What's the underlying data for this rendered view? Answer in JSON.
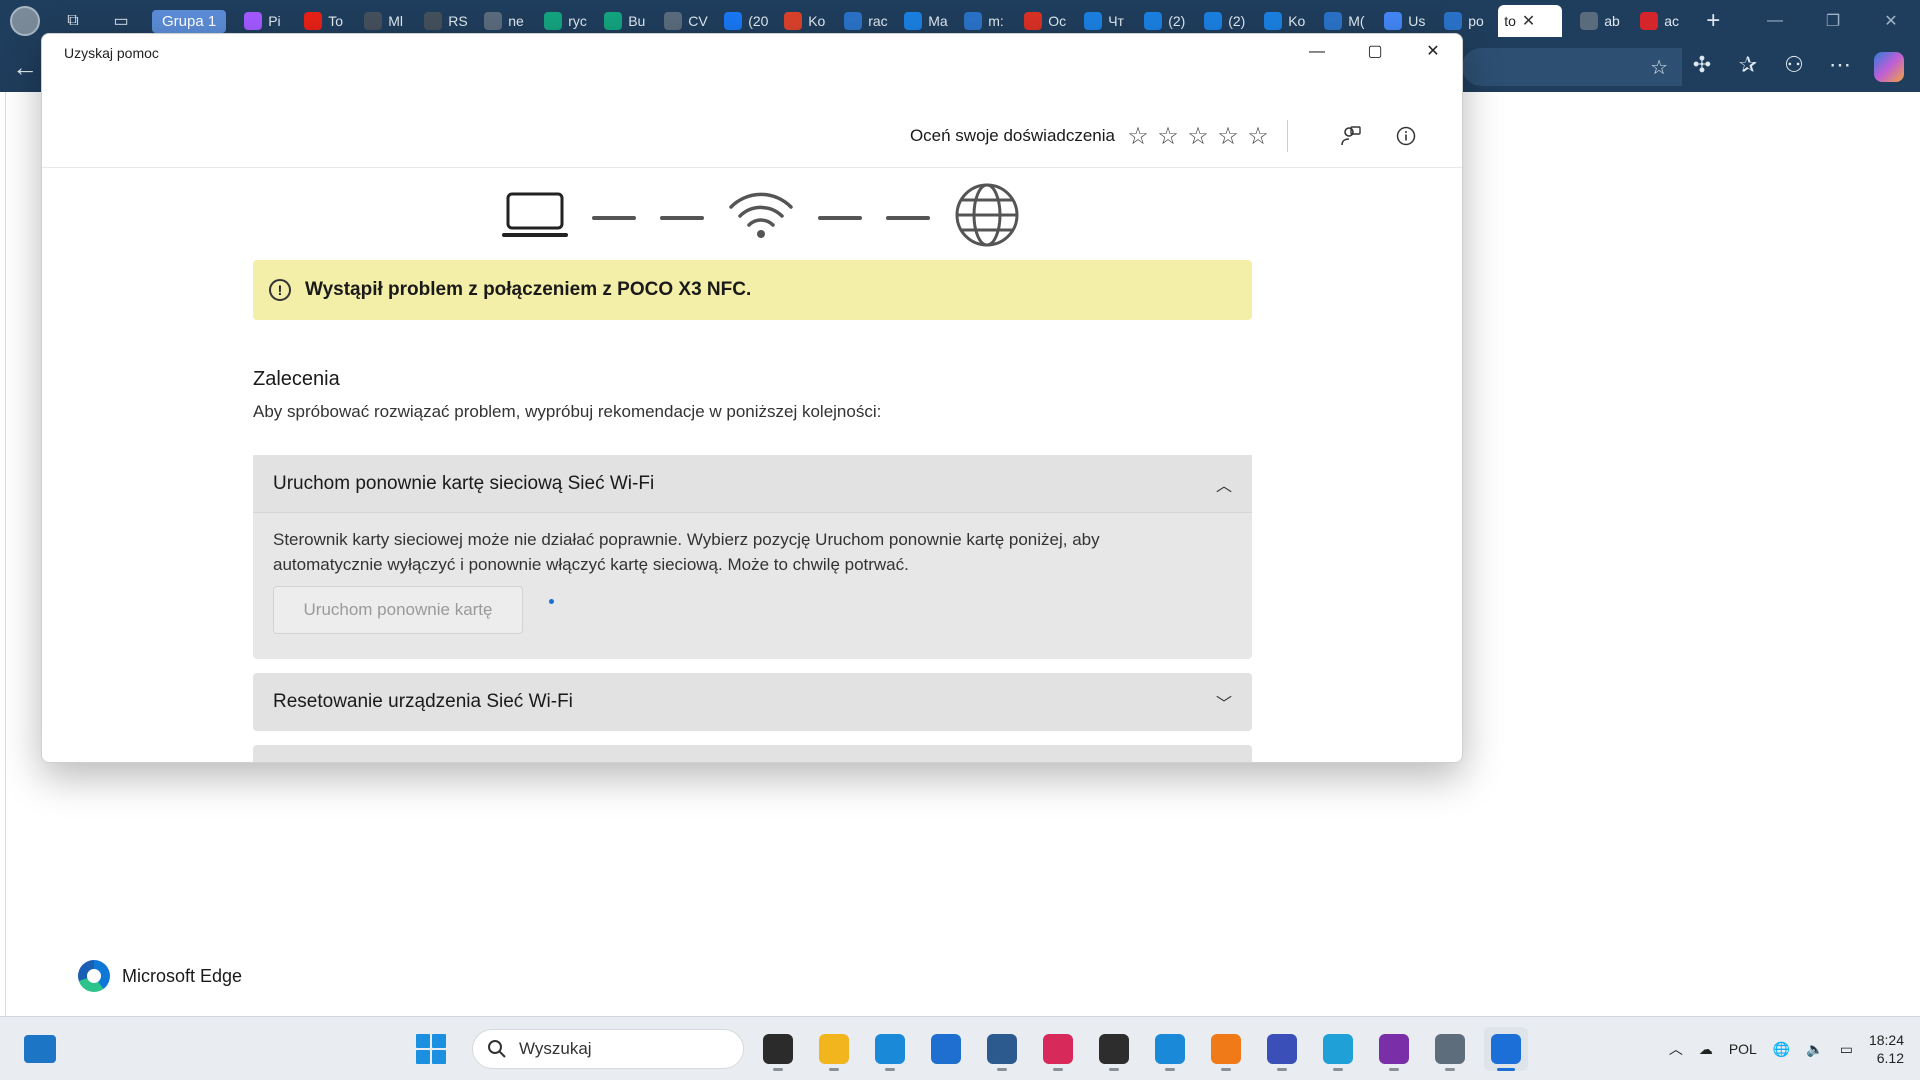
{
  "browser": {
    "tab_group": "Grupa 1",
    "tabs": [
      {
        "label": "Pi",
        "icon": "figma-icon",
        "color": "#a259ff"
      },
      {
        "label": "To",
        "icon": "youtube-icon",
        "color": "#e62117"
      },
      {
        "label": "Ml",
        "icon": "stripes-icon",
        "color": "#44505c"
      },
      {
        "label": "RS",
        "icon": "stripes-icon",
        "color": "#44505c"
      },
      {
        "label": "ne",
        "icon": "globe-icon",
        "color": "#5a6b7d"
      },
      {
        "label": "ryc",
        "icon": "diamond-icon",
        "color": "#14a37f"
      },
      {
        "label": "Bu",
        "icon": "diamond-icon",
        "color": "#14a37f"
      },
      {
        "label": "CV",
        "icon": "globe-icon",
        "color": "#5a6b7d"
      },
      {
        "label": "(20",
        "icon": "facebook-icon",
        "color": "#1877f2"
      },
      {
        "label": "Ko",
        "icon": "check-icon",
        "color": "#d9412b"
      },
      {
        "label": "rac",
        "icon": "search-icon",
        "color": "#2a72c7"
      },
      {
        "label": "Ma",
        "icon": "at-icon",
        "color": "#1b7fe0"
      },
      {
        "label": "m:",
        "icon": "search-icon",
        "color": "#2a72c7"
      },
      {
        "label": "Oc",
        "icon": "gmail-icon",
        "color": "#d93025"
      },
      {
        "label": "Чт",
        "icon": "at-icon",
        "color": "#1b7fe0"
      },
      {
        "label": "(2)",
        "icon": "mail-icon",
        "color": "#1b7fe0"
      },
      {
        "label": "(2)",
        "icon": "mail-icon",
        "color": "#1b7fe0"
      },
      {
        "label": "Ko",
        "icon": "person-icon",
        "color": "#1b7fe0"
      },
      {
        "label": "M(",
        "icon": "search-icon",
        "color": "#2a72c7"
      },
      {
        "label": "Us",
        "icon": "google-icon",
        "color": "#4285f4"
      },
      {
        "label": "po",
        "icon": "search-icon",
        "color": "#2a72c7"
      }
    ],
    "active_tab": {
      "label": "to"
    },
    "tabs_after": [
      {
        "label": "ab",
        "icon": "globe-icon",
        "color": "#5a6b7d"
      },
      {
        "label": "ac",
        "icon": "pdf-icon",
        "color": "#d4262a"
      }
    ]
  },
  "dialog": {
    "title": "Uzyskaj pomoc",
    "rating_label": "Oceń swoje doświadczenia",
    "stars": [
      "☆",
      "☆",
      "☆",
      "☆",
      "☆"
    ],
    "warning": "Wystąpił problem z połączeniem z POCO X3 NFC.",
    "section_title": "Zalecenia",
    "section_subtitle": "Aby spróbować rozwiązać problem, wypróbuj rekomendacje w poniższej kolejności:",
    "card1": {
      "title": "Uruchom ponownie kartę sieciową Sieć Wi-Fi",
      "body": "Sterownik karty sieciowej może nie działać poprawnie. Wybierz pozycję Uruchom ponownie kartę poniżej, aby automatycznie wyłączyć i ponownie włączyć kartę sieciową. Może to chwilę potrwać.",
      "button": "Uruchom ponownie kartę"
    },
    "card2": {
      "title": "Resetowanie urządzenia Sieć Wi-Fi"
    }
  },
  "page": {
    "brand": "Microsoft Edge"
  },
  "taskbar": {
    "search_placeholder": "Wyszukaj",
    "apps": [
      {
        "name": "file-explorer-dark-icon",
        "color": "#2b2b2b",
        "running": true
      },
      {
        "name": "file-explorer-icon",
        "color": "#f2b51e",
        "running": true
      },
      {
        "name": "edge-icon",
        "color": "#1a8ad8",
        "running": true
      },
      {
        "name": "store-icon",
        "color": "#1f6fd0",
        "running": false
      },
      {
        "name": "virtualbox-icon",
        "color": "#2c5a8f",
        "running": true
      },
      {
        "name": "app-pink-icon",
        "color": "#d82a5a",
        "running": true
      },
      {
        "name": "terminal-icon",
        "color": "#2d2d2d",
        "running": true
      },
      {
        "name": "voice-icon",
        "color": "#1a8ad8",
        "running": true
      },
      {
        "name": "media-player-icon",
        "color": "#f07a18",
        "running": true
      },
      {
        "name": "save-icon",
        "color": "#3a4fb8",
        "running": true
      },
      {
        "name": "notepad-icon",
        "color": "#1fa0d6",
        "running": true
      },
      {
        "name": "github-icon",
        "color": "#7a2fa8",
        "running": true
      },
      {
        "name": "settings-icon",
        "color": "#5e6d7c",
        "running": true
      },
      {
        "name": "get-help-icon",
        "color": "#1b6fd6",
        "running": true,
        "active": true
      }
    ],
    "lang": "POL",
    "time": "18:24",
    "date": "6.12"
  }
}
